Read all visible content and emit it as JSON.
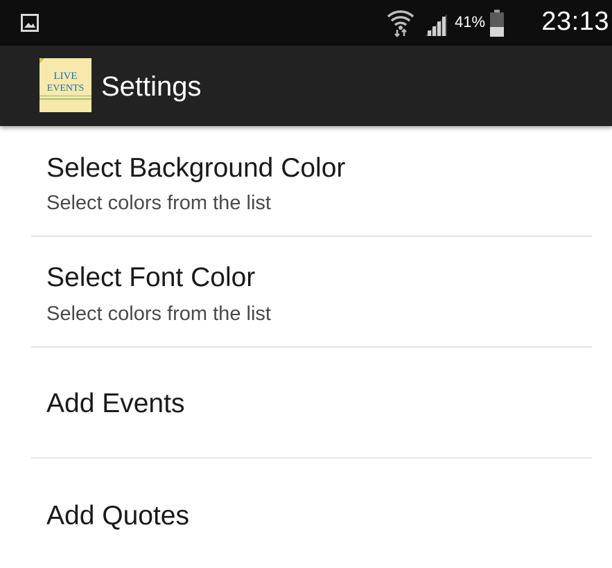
{
  "status_bar": {
    "notification_icon": "gallery-icon",
    "wifi_icon": "wifi-icon",
    "signal_icon": "signal-icon",
    "battery_percent": "41%",
    "battery_icon": "battery-icon",
    "battery_level": 0.41,
    "time": "23:13"
  },
  "action_bar": {
    "logo_line1": "LIVE",
    "logo_line2": "EVENTS",
    "title": "Settings"
  },
  "preferences": [
    {
      "title": "Select Background Color",
      "summary": "Select colors from the list"
    },
    {
      "title": "Select Font Color",
      "summary": "Select colors from the list"
    },
    {
      "title": "Add Events",
      "summary": ""
    },
    {
      "title": "Add Quotes",
      "summary": ""
    }
  ],
  "colors": {
    "status_bar_bg": "#0e0e0e",
    "action_bar_bg": "#222222",
    "content_bg": "#ffffff",
    "text_primary": "#1a1a1a",
    "text_secondary": "#4a4a4a",
    "divider": "#e4e4e4"
  }
}
